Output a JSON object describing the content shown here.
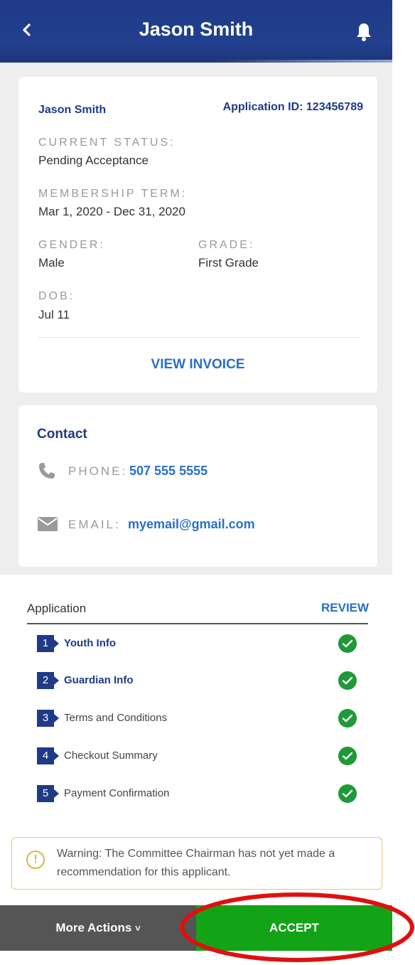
{
  "header": {
    "title": "Jason Smith",
    "back_icon": "chevron-left-icon",
    "bell_icon": "bell-icon"
  },
  "profile": {
    "name": "Jason Smith",
    "application_id": "Application ID: 123456789",
    "current_status_label": "CURRENT STATUS:",
    "current_status": "Pending Acceptance",
    "membership_term_label": "MEMBERSHIP TERM:",
    "membership_term": "Mar 1, 2020 - Dec 31, 2020",
    "gender_label": "GENDER:",
    "gender": "Male",
    "grade_label": "GRADE:",
    "grade": "First Grade",
    "dob_label": "DOB:",
    "dob": "Jul 11",
    "view_invoice": "VIEW INVOICE"
  },
  "contact": {
    "title": "Contact",
    "phone_label": "PHONE:",
    "phone": "507 555 5555",
    "email_label": "EMAIL:",
    "email": "myemail@gmail.com"
  },
  "application": {
    "title": "Application",
    "review": "REVIEW",
    "steps": [
      {
        "num": "1",
        "label": "Youth Info",
        "bold": true
      },
      {
        "num": "2",
        "label": "Guardian Info",
        "bold": true
      },
      {
        "num": "3",
        "label": "Terms and Conditions",
        "bold": false
      },
      {
        "num": "4",
        "label": "Checkout Summary",
        "bold": false
      },
      {
        "num": "5",
        "label": "Payment Confirmation",
        "bold": false
      }
    ]
  },
  "warning": {
    "icon": "!",
    "text": "Warning: The Committee Chairman has not yet made a recommendation for this applicant."
  },
  "actions": {
    "more_actions": "More Actions",
    "more_chevron": "˅",
    "accept": "ACCEPT"
  },
  "colors": {
    "primary": "#1f3a86",
    "link": "#2a6fc4",
    "success": "#12a316",
    "annotation": "#e01010",
    "warning": "#e0b34b"
  }
}
